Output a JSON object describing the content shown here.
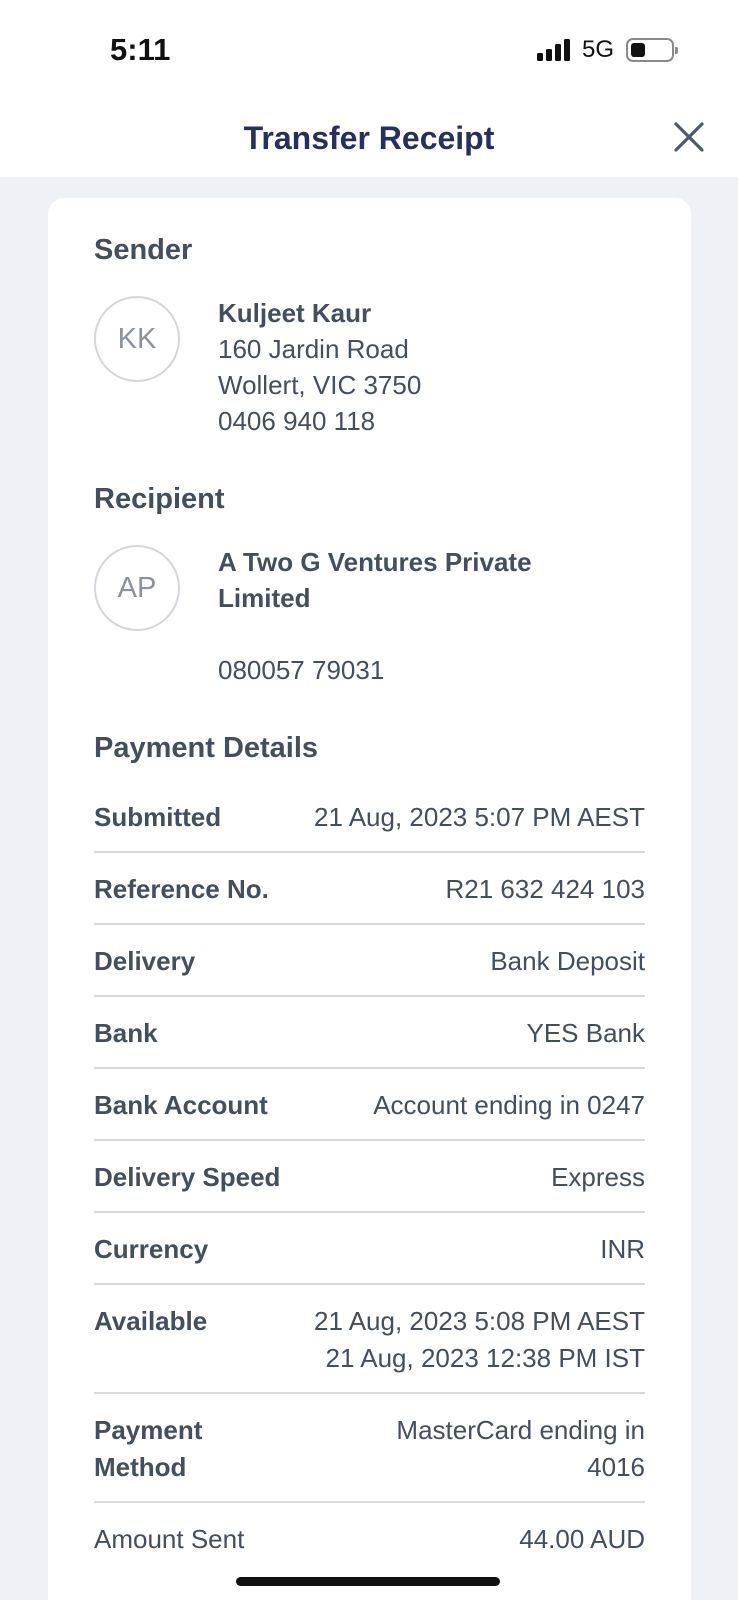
{
  "status_bar": {
    "time": "5:11",
    "network": "5G"
  },
  "nav": {
    "title": "Transfer Receipt",
    "close_icon": "close-icon"
  },
  "sender": {
    "heading": "Sender",
    "initials": "KK",
    "name": "Kuljeet Kaur",
    "address_line1": "160 Jardin Road",
    "address_line2": "Wollert, VIC 3750",
    "phone": "0406 940 118"
  },
  "recipient": {
    "heading": "Recipient",
    "initials": "AP",
    "name_line1": "A Two G Ventures Private",
    "name_line2": "Limited",
    "account": "080057 79031"
  },
  "payment": {
    "heading": "Payment Details",
    "rows": [
      {
        "label": "Submitted",
        "value": "21 Aug, 2023 5:07 PM AEST"
      },
      {
        "label": "Reference No.",
        "value": "R21 632 424 103"
      },
      {
        "label": "Delivery",
        "value": "Bank Deposit"
      },
      {
        "label": "Bank",
        "value": "YES Bank"
      },
      {
        "label": "Bank Account",
        "value": "Account ending in 0247"
      },
      {
        "label": "Delivery Speed",
        "value": "Express"
      },
      {
        "label": "Currency",
        "value": "INR"
      },
      {
        "label": "Available",
        "value_line1": "21 Aug, 2023 5:08 PM AEST",
        "value_line2": "21 Aug, 2023 12:38 PM IST"
      },
      {
        "label_line1": "Payment",
        "label_line2": "Method",
        "value_line1": "MasterCard ending in",
        "value_line2": "4016"
      },
      {
        "label": "Amount Sent",
        "value": "44.00 AUD"
      }
    ]
  }
}
